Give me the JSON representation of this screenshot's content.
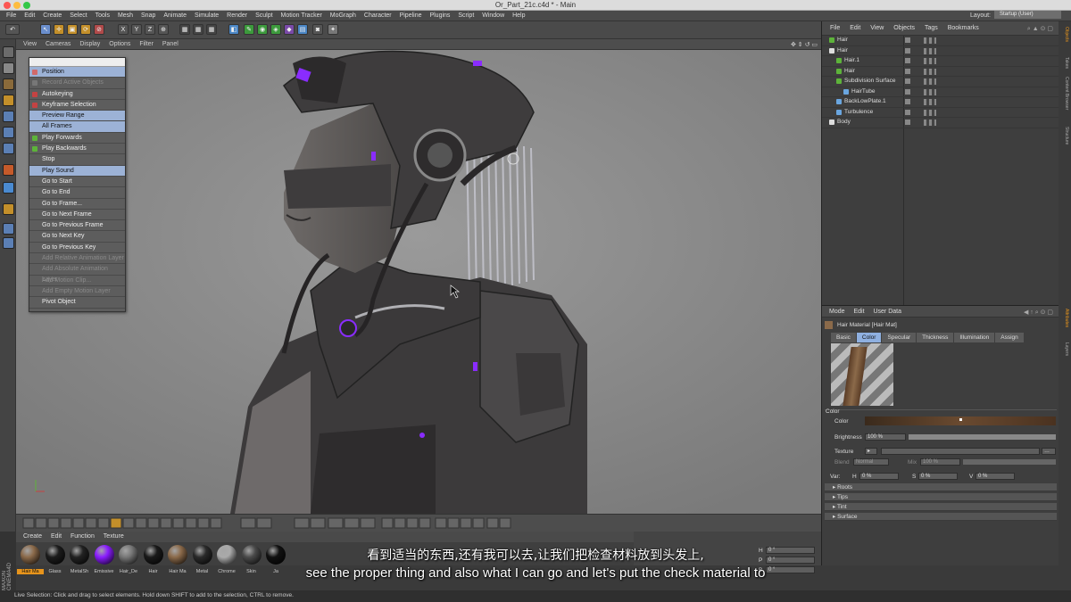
{
  "window": {
    "title": "Or_Part_21c.c4d * - Main"
  },
  "menubar": {
    "items": [
      "File",
      "Edit",
      "Create",
      "Select",
      "Tools",
      "Mesh",
      "Snap",
      "Animate",
      "Simulate",
      "Render",
      "Sculpt",
      "Motion Tracker",
      "MoGraph",
      "Character",
      "Pipeline",
      "Plugins",
      "Script",
      "Window",
      "Help"
    ],
    "layout_label": "Layout:",
    "layout_value": "Startup (User)"
  },
  "toolbar": {
    "axis_x": "X",
    "axis_y": "Y",
    "axis_z": "Z"
  },
  "viewport": {
    "menu": [
      "View",
      "Cameras",
      "Display",
      "Options",
      "Filter",
      "Panel"
    ]
  },
  "context_menu": {
    "items": [
      {
        "label": "Position",
        "state": "highlight",
        "icon": "#d16a6a"
      },
      {
        "label": "Record Active Objects",
        "state": "disabled",
        "icon": "#777777"
      },
      {
        "label": "Autokeying",
        "state": "normal",
        "icon": "#c44343"
      },
      {
        "label": "Keyframe Selection",
        "state": "normal",
        "icon": "#c44343"
      },
      {
        "label": "Preview Range",
        "state": "highlight",
        "icon": ""
      },
      {
        "label": "All Frames",
        "state": "highlight",
        "icon": ""
      },
      {
        "label": "Play Forwards",
        "state": "normal",
        "icon": "#5db33a"
      },
      {
        "label": "Play Backwards",
        "state": "normal",
        "icon": "#5db33a"
      },
      {
        "label": "Stop",
        "state": "normal",
        "icon": ""
      },
      {
        "label": "Play Sound",
        "state": "highlight",
        "icon": ""
      },
      {
        "label": "Go to Start",
        "state": "normal",
        "icon": ""
      },
      {
        "label": "Go to End",
        "state": "normal",
        "icon": ""
      },
      {
        "label": "Go to Frame...",
        "state": "normal",
        "icon": ""
      },
      {
        "label": "Go to Next Frame",
        "state": "normal",
        "icon": ""
      },
      {
        "label": "Go to Previous Frame",
        "state": "normal",
        "icon": ""
      },
      {
        "label": "Go to Next Key",
        "state": "normal",
        "icon": ""
      },
      {
        "label": "Go to Previous Key",
        "state": "normal",
        "icon": ""
      },
      {
        "label": "Add Relative Animation Layer",
        "state": "disabled",
        "icon": ""
      },
      {
        "label": "Add Absolute Animation Layer",
        "state": "disabled",
        "icon": ""
      },
      {
        "label": "Add Motion Clip...",
        "state": "disabled",
        "icon": ""
      },
      {
        "label": "Add Empty Motion Layer",
        "state": "disabled",
        "icon": ""
      },
      {
        "label": "Pivot Object",
        "state": "normal",
        "icon": ""
      }
    ]
  },
  "object_manager": {
    "menu": [
      "File",
      "Edit",
      "View",
      "Objects",
      "Tags",
      "Bookmarks"
    ],
    "objects": [
      {
        "name": "Hair",
        "indent": 0,
        "color": "#5db33a"
      },
      {
        "name": "Hair",
        "indent": 0,
        "color": "#dddddd"
      },
      {
        "name": "Hair.1",
        "indent": 1,
        "color": "#5db33a"
      },
      {
        "name": "Hair",
        "indent": 1,
        "color": "#5db33a"
      },
      {
        "name": "Subdivision Surface",
        "indent": 1,
        "color": "#5db33a"
      },
      {
        "name": "HairTube",
        "indent": 2,
        "color": "#6aa6e0"
      },
      {
        "name": "BackLowPlate.1",
        "indent": 1,
        "color": "#6aa6e0"
      },
      {
        "name": "Turbulence",
        "indent": 1,
        "color": "#6aa6e0"
      },
      {
        "name": "Body",
        "indent": 0,
        "color": "#dddddd"
      }
    ]
  },
  "attribute_manager": {
    "menu": [
      "Mode",
      "Edit",
      "User Data"
    ],
    "material_name": "Hair Material [Hair Mat]",
    "tabs": [
      "Basic",
      "Color",
      "Specular",
      "Thickness",
      "Illumination",
      "Assign"
    ],
    "active_tab": "Color",
    "section_title": "Color",
    "color_label": "Color",
    "brightness_label": "Brightness",
    "brightness_value": "100 %",
    "texture_label": "Texture",
    "blend_label": "Blend",
    "blend_value": "Normal",
    "mix_label": "Mix",
    "mix_value": "100 %",
    "var_label": "Var:",
    "h_label": "H",
    "h_value": "0 %",
    "s_label": "S",
    "s_value": "0 %",
    "v_label": "V",
    "v_value": "0 %",
    "collapsed_sections": [
      "Roots",
      "Tips",
      "Tint",
      "Surface"
    ]
  },
  "right_tabs": [
    "Objects",
    "Takes",
    "Content Browser",
    "Structure",
    "Attributes",
    "Layers"
  ],
  "material_manager": {
    "menu": [
      "Create",
      "Edit",
      "Function",
      "Texture"
    ],
    "materials": [
      {
        "label": "Hair Ma",
        "color": "#8b6a4a",
        "selected": true
      },
      {
        "label": "Glass",
        "color": "#1c1c1c",
        "selected": false
      },
      {
        "label": "MetalSh",
        "color": "#222222",
        "selected": false
      },
      {
        "label": "Emissive",
        "color": "#8a1cff",
        "selected": false
      },
      {
        "label": "Hair_De",
        "color": "#777777",
        "selected": false
      },
      {
        "label": "Hair",
        "color": "#1a1a1a",
        "selected": false
      },
      {
        "label": "Hair Ma",
        "color": "#8b6a4a",
        "selected": false
      },
      {
        "label": "Metal",
        "color": "#2a2a2a",
        "selected": false
      },
      {
        "label": "Chrome",
        "color": "#aaaaaa",
        "selected": false
      },
      {
        "label": "Skin",
        "color": "#4a4a4a",
        "selected": false
      },
      {
        "label": "Ja",
        "color": "#111111",
        "selected": false
      }
    ]
  },
  "coordinates": {
    "h_label": "H",
    "h_value": "0 °",
    "p_label": "P",
    "p_value": "0 °",
    "b_label": "B",
    "b_value": "0 °"
  },
  "statusbar": {
    "text": "Live Selection: Click and drag to select elements. Hold down SHIFT to add to the selection, CTRL to remove."
  },
  "subtitle": {
    "zh": "看到适当的东西,还有我可以去,让我们把检查材料放到头发上,",
    "en": "see the proper thing and also what I can go and let's put the check material to"
  }
}
